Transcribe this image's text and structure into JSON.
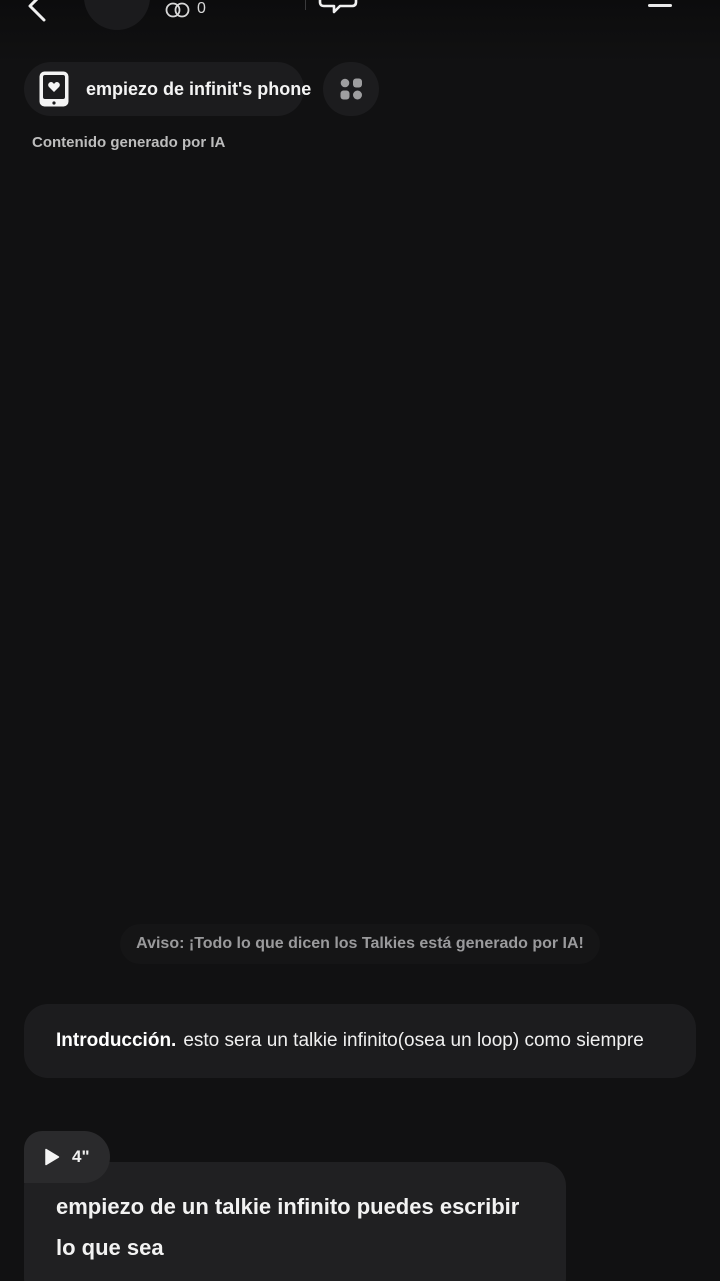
{
  "header": {
    "likes_count": "0",
    "icons": {
      "back": "chevron-left-icon",
      "likes": "infinity-icon",
      "chat": "chat-bubble-icon",
      "menu": "menu-icon"
    }
  },
  "character": {
    "name": "empiezo de infinit's phone",
    "icon": "phone-heart-icon",
    "grid_icon": "grid-icon",
    "ai_notice": "Contenido generado por IA"
  },
  "disclaimer": "Aviso: ¡Todo lo que dicen los Talkies está generado por IA!",
  "intro": {
    "title": "Introducción.",
    "text": "esto sera un talkie infinito(osea un loop) como siempre"
  },
  "message": {
    "audio_duration": "4\"",
    "text": "empiezo de un talkie infinito puedes escribir lo que sea"
  },
  "colors": {
    "background": "#111112",
    "card": "#1c1c1e",
    "bubble": "#202022",
    "text": "#f2f2f2",
    "muted": "#9a9a9c"
  }
}
